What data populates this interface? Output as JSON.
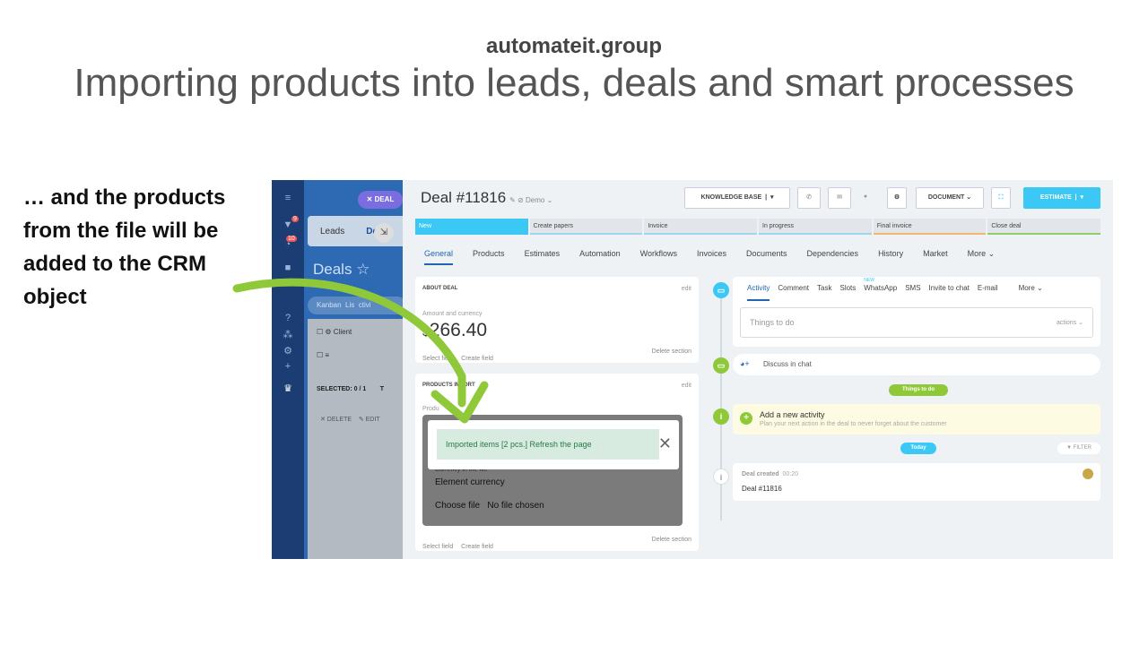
{
  "slide": {
    "site": "automateit.group",
    "title": "Importing products into leads, deals and smart processes",
    "caption": "… and the products from the file will be added to the CRM object"
  },
  "sidebar": {
    "badge_1": "9",
    "badge_2": "10",
    "deal_chip": "✕ DEAL",
    "leads": "Leads",
    "deals_tab": "De",
    "deals_title": "Deals ☆",
    "kanban": "Kanban",
    "list": "Lis",
    "activity": "ctivi",
    "row_client": "Client",
    "selected": "SELECTED: 0 / 1",
    "selected_extra": "T",
    "delete": "✕ DELETE",
    "edit": "✎ EDIT"
  },
  "deal": {
    "title": "Deal #11816",
    "demo": "✎ ⊘ Demo ⌄"
  },
  "toolbar": {
    "knowledge_base": "KNOWLEDGE BASE",
    "document": "DOCUMENT ⌄",
    "estimate": "ESTIMATE"
  },
  "stages": [
    "New",
    "Create papers",
    "Invoice",
    "In progress",
    "Final invoice",
    "Close deal"
  ],
  "tabs": [
    "General",
    "Products",
    "Estimates",
    "Automation",
    "Workflows",
    "Invoices",
    "Documents",
    "Dependencies",
    "History",
    "Market",
    "More ⌄"
  ],
  "about": {
    "header": "ABOUT DEAL",
    "edit": "edit",
    "amount_label": "Amount and currency",
    "amount_currency": "$",
    "amount": "266.40",
    "select_field": "Select field",
    "create_field": "Create field",
    "delete_section": "Delete section"
  },
  "import": {
    "header": "PRODUCTS IMPORT",
    "edit": "edit",
    "products_label": "Produ",
    "notice": "Imported items [2 pcs.] Refresh the page",
    "close": "✕",
    "currency_label": "Currency in the file",
    "currency_value": "Element currency",
    "choose_file": "Choose file",
    "no_file": "No file chosen",
    "select_field": "Select field",
    "create_field": "Create field",
    "delete_section": "Delete section"
  },
  "feed": {
    "tabs": [
      "Activity",
      "Comment",
      "Task",
      "Slots",
      "WhatsApp",
      "SMS",
      "Invite to chat",
      "E-mail",
      "More ⌄"
    ],
    "new_badge": "NEW",
    "things_todo": "Things to do",
    "actions": "actions ⌄",
    "discuss": "Discuss in chat",
    "things_pill": "Things to do",
    "add_activity": "Add a new activity",
    "add_hint": "Plan your next action in the deal to never forget about the customer",
    "today": "Today",
    "filter": "▼ FILTER",
    "created": "Deal created",
    "created_time": "00:20",
    "created_deal": "Deal #11816"
  },
  "colors": {
    "accent": "#3bc8f5",
    "arrow": "#8fc93a",
    "sidebar": "#1b3d73"
  }
}
